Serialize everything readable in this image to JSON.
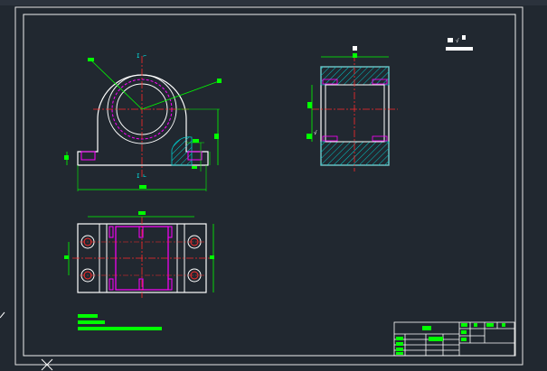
{
  "app": {
    "title": ""
  },
  "drawing": {
    "sheet": {
      "border": "#e6e6e6",
      "frame": "#f0f0f0"
    },
    "colors": {
      "background": "#212830",
      "outline": "#ffffff",
      "dimension": "#00ff00",
      "centerline": "#ff2a2a",
      "hidden": "#ff00ff",
      "hatch": "#00c8c8",
      "text_block": "#00ff00"
    },
    "roughness_symbol": "√",
    "marks": {
      "section_top": "I ⌐",
      "section_bottom": "I ∟"
    }
  }
}
